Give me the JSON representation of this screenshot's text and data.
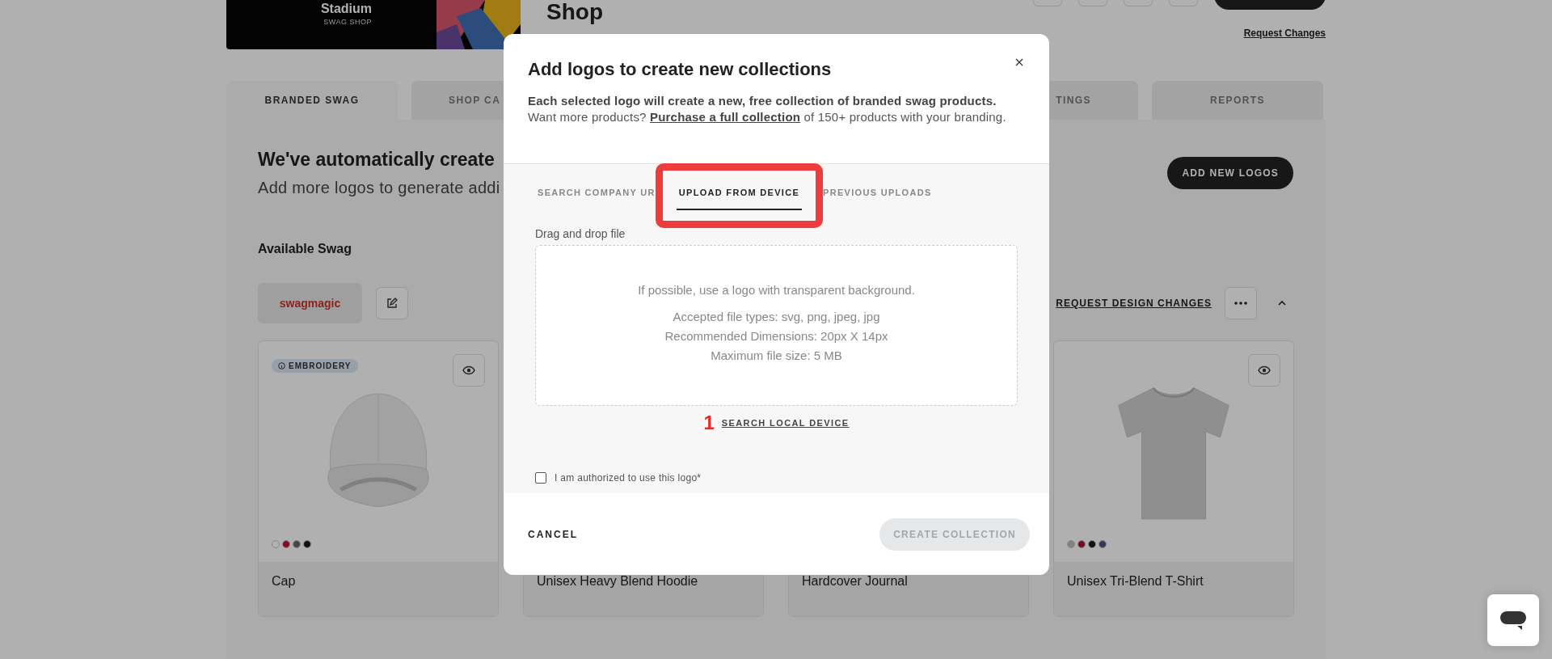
{
  "banner": {
    "brand": "Stadium",
    "subtitle": "SWAG SHOP"
  },
  "page_title": "Shop",
  "request_changes": "Request Changes",
  "tabs": [
    {
      "label": "BRANDED SWAG",
      "selected": true
    },
    {
      "label": "SHOP CA",
      "selected": false
    },
    {
      "label": "TINGS",
      "selected": false
    },
    {
      "label": "REPORTS",
      "selected": false
    }
  ],
  "intro": {
    "title": "We've automatically create",
    "subtitle": "Add more logos to generate addi"
  },
  "add_logos_button": "ADD NEW LOGOS",
  "section_title": "Available Swag",
  "logo_chip": "swagmagic",
  "request_design_changes": "REQUEST DESIGN CHANGES",
  "products": [
    {
      "name": "Cap",
      "kind": "cap",
      "badge": "EMBROIDERY",
      "swatches": [
        {
          "color": "#b0b0b0"
        },
        {
          "color": "#8a0b20"
        },
        {
          "color": "#464646"
        },
        {
          "color": "#121212"
        }
      ]
    },
    {
      "name": "Unisex Heavy Blend Hoodie"
    },
    {
      "name": "Hardcover Journal"
    },
    {
      "name": "Unisex Tri-Blend T-Shirt",
      "kind": "tshirt",
      "swatches": [
        {
          "color": "#828282"
        },
        {
          "color": "#790b20"
        },
        {
          "color": "#121212"
        },
        {
          "color": "#33385a"
        }
      ]
    }
  ],
  "modal": {
    "title": "Add logos to create new collections",
    "description": "**Each selected logo will create a new, free collection of branded swag products.** Want more products?",
    "description_link": "Purchase a full collection",
    "description_end": "of 150+ products with your branding.",
    "tabs": [
      {
        "label": "SEARCH COMPANY UR",
        "selected": false,
        "highlighted": false
      },
      {
        "label": "UPLOAD FROM DEVICE",
        "selected": true,
        "highlighted": true
      },
      {
        "label": "PREVIOUS UPLOADS",
        "selected": false,
        "highlighted": false
      }
    ],
    "drop_label": "Drag and drop file",
    "drop_hint": "If possible, use a logo with transparent background.",
    "requirements": [
      "Accepted file types: svg, png, jpeg, jpg",
      "Recommended Dimensions: 20px X 14px",
      "Maximum file size: 5 MB"
    ],
    "step_marker": "1",
    "search_link": "SEARCH LOCAL DEVICE",
    "authorized": {
      "label": "I am authorized to use this logo*",
      "checked": false
    },
    "cancel": "CANCEL",
    "create": {
      "label": "CREATE COLLECTION",
      "disabled": true
    }
  }
}
